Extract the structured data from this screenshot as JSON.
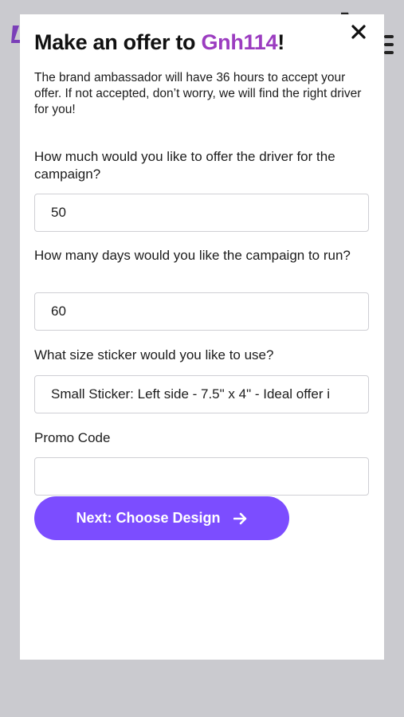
{
  "modal": {
    "title_prefix": "Make an offer to ",
    "title_name": "Gnh114",
    "title_suffix": "!",
    "intro": "The brand ambassador will have 36 hours to accept your offer. If not accepted, don’t worry, we will find the right driver for you!",
    "accent_color": "#9b3cc0",
    "button_color": "#7c4dff"
  },
  "form": {
    "amount": {
      "label": "How much would you like to offer the driver for the campaign?",
      "value": "50"
    },
    "days": {
      "label": "How many days would you like the campaign to run?",
      "value": "60"
    },
    "sticker": {
      "label": "What size sticker would you like to use?",
      "value": "Small Sticker: Left side - 7.5\" x 4\" - Ideal offer i"
    },
    "promo": {
      "label": "Promo Code",
      "value": ""
    },
    "next_label": "Next: Choose Design"
  },
  "icons": {
    "close": "close-icon",
    "arrow": "arrow-right-icon",
    "menu": "hamburger-menu-icon",
    "cart": "cart-icon"
  }
}
